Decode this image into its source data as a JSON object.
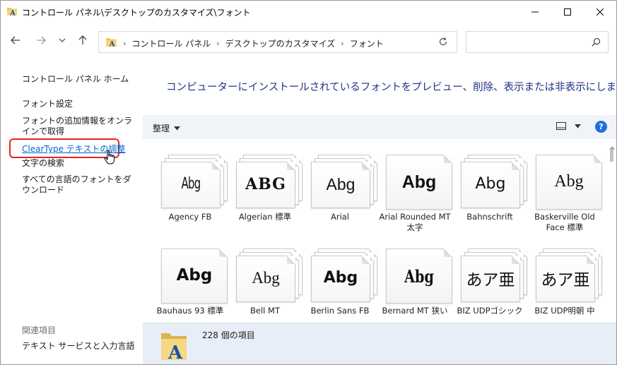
{
  "window": {
    "title": "コントロール パネル\\デスクトップのカスタマイズ\\フォント"
  },
  "address": {
    "crumbs": [
      "コントロール パネル",
      "デスクトップのカスタマイズ",
      "フォント"
    ],
    "search_placeholder": ""
  },
  "left_pane": {
    "home": "コントロール パネル ホーム",
    "font_settings": "フォント設定",
    "get_more": "フォントの追加情報をオンラインで取得",
    "cleartype": "ClearType テキストの調整",
    "find_char": "文字の検索",
    "download_all": "すべての言語のフォントをダウンロード",
    "see_also": "関連項目",
    "text_services": "テキスト サービスと入力言語"
  },
  "main": {
    "heading": "コンピューターにインストールされているフォントをプレビュー、削除、表示または非表示にします",
    "organize": "整理",
    "help": "?",
    "status": "228 個の項目"
  },
  "fonts": [
    {
      "name": "Agency FB",
      "sample": "Abg"
    },
    {
      "name": "Algerian 標準",
      "sample": "ABG"
    },
    {
      "name": "Arial",
      "sample": "Abg"
    },
    {
      "name": "Arial Rounded MT 太字",
      "sample": "Abg"
    },
    {
      "name": "Bahnschrift",
      "sample": "Abg"
    },
    {
      "name": "Baskerville Old Face 標準",
      "sample": "Abg"
    },
    {
      "name": "Bauhaus 93 標準",
      "sample": "Abg"
    },
    {
      "name": "Bell MT",
      "sample": "Abg"
    },
    {
      "name": "Berlin Sans FB",
      "sample": "Abg"
    },
    {
      "name": "Bernard MT 狭い",
      "sample": "Abg"
    },
    {
      "name": "BIZ UDPゴシック",
      "sample": "あア亜"
    },
    {
      "name": "BIZ UDP明朝 中",
      "sample": "あア亜"
    }
  ]
}
